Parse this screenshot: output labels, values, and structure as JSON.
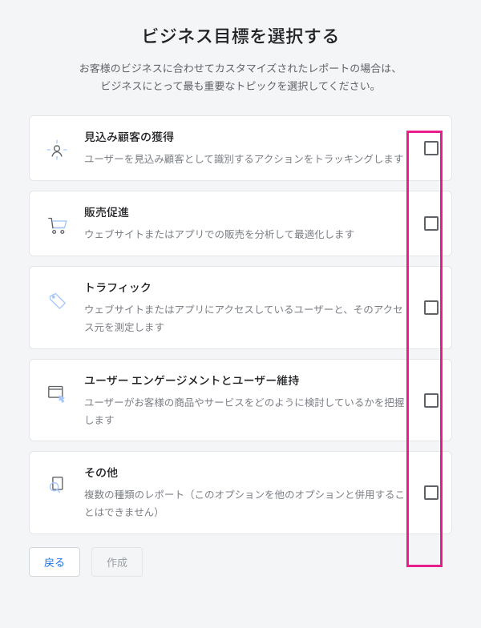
{
  "title": "ビジネス目標を選択する",
  "subtitle_line1": "お客様のビジネスに合わせてカスタマイズされたレポートの場合は、",
  "subtitle_line2": "ビジネスにとって最も重要なトピックを選択してください。",
  "options": [
    {
      "label": "見込み顧客の獲得",
      "desc": "ユーザーを見込み顧客として識別するアクションをトラッキングします",
      "icon": "target-person"
    },
    {
      "label": "販売促進",
      "desc": "ウェブサイトまたはアプリでの販売を分析して最適化します",
      "icon": "cart"
    },
    {
      "label": "トラフィック",
      "desc": "ウェブサイトまたはアプリにアクセスしているユーザーと、そのアクセス元を測定します",
      "icon": "tag"
    },
    {
      "label": "ユーザー エンゲージメントとユーザー維持",
      "desc": "ユーザーがお客様の商品やサービスをどのように検討しているかを把握します",
      "icon": "window-click"
    },
    {
      "label": "その他",
      "desc": "複数の種類のレポート（このオプションを他のオプションと併用することはできません）",
      "icon": "magnifier-doc"
    }
  ],
  "buttons": {
    "back": "戻る",
    "create": "作成"
  }
}
